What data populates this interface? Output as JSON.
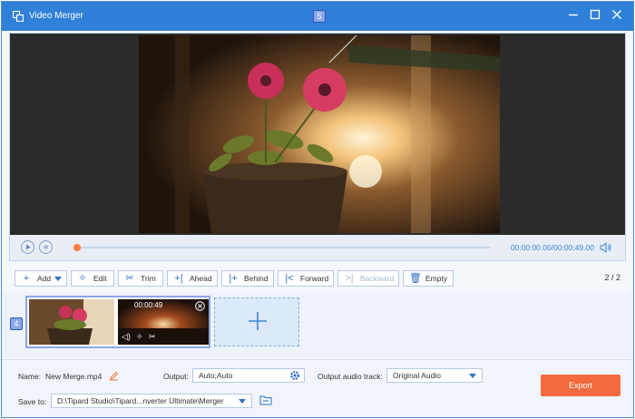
{
  "window": {
    "title": "Video Merger",
    "badge_top": "5",
    "badge_timeline": "4"
  },
  "player": {
    "time_current": "00:00:00.00",
    "time_total": "00:00:49.00",
    "progress": 0.0
  },
  "toolbar": {
    "add": "Add",
    "edit": "Edit",
    "trim": "Trim",
    "ahead": "Ahead",
    "behind": "Behind",
    "forward": "Forward",
    "backward": "Backward",
    "empty": "Empty",
    "page": "2 / 2"
  },
  "clips": [
    {
      "duration": ""
    },
    {
      "duration": "00:00:49"
    }
  ],
  "bottom": {
    "name_label": "Name:",
    "name_value": "New Merge.mp4",
    "output_label": "Output:",
    "output_value": "Auto;Auto",
    "audio_label": "Output audio track:",
    "audio_value": "Original Audio",
    "save_label": "Save to:",
    "save_value": "D:\\Tipard Studio\\Tipard...nverter Ultimate\\Merger",
    "export_label": "Export"
  },
  "colors": {
    "accent": "#2f80d8",
    "export": "#f26a3d",
    "progress": "#ff7a3d"
  }
}
